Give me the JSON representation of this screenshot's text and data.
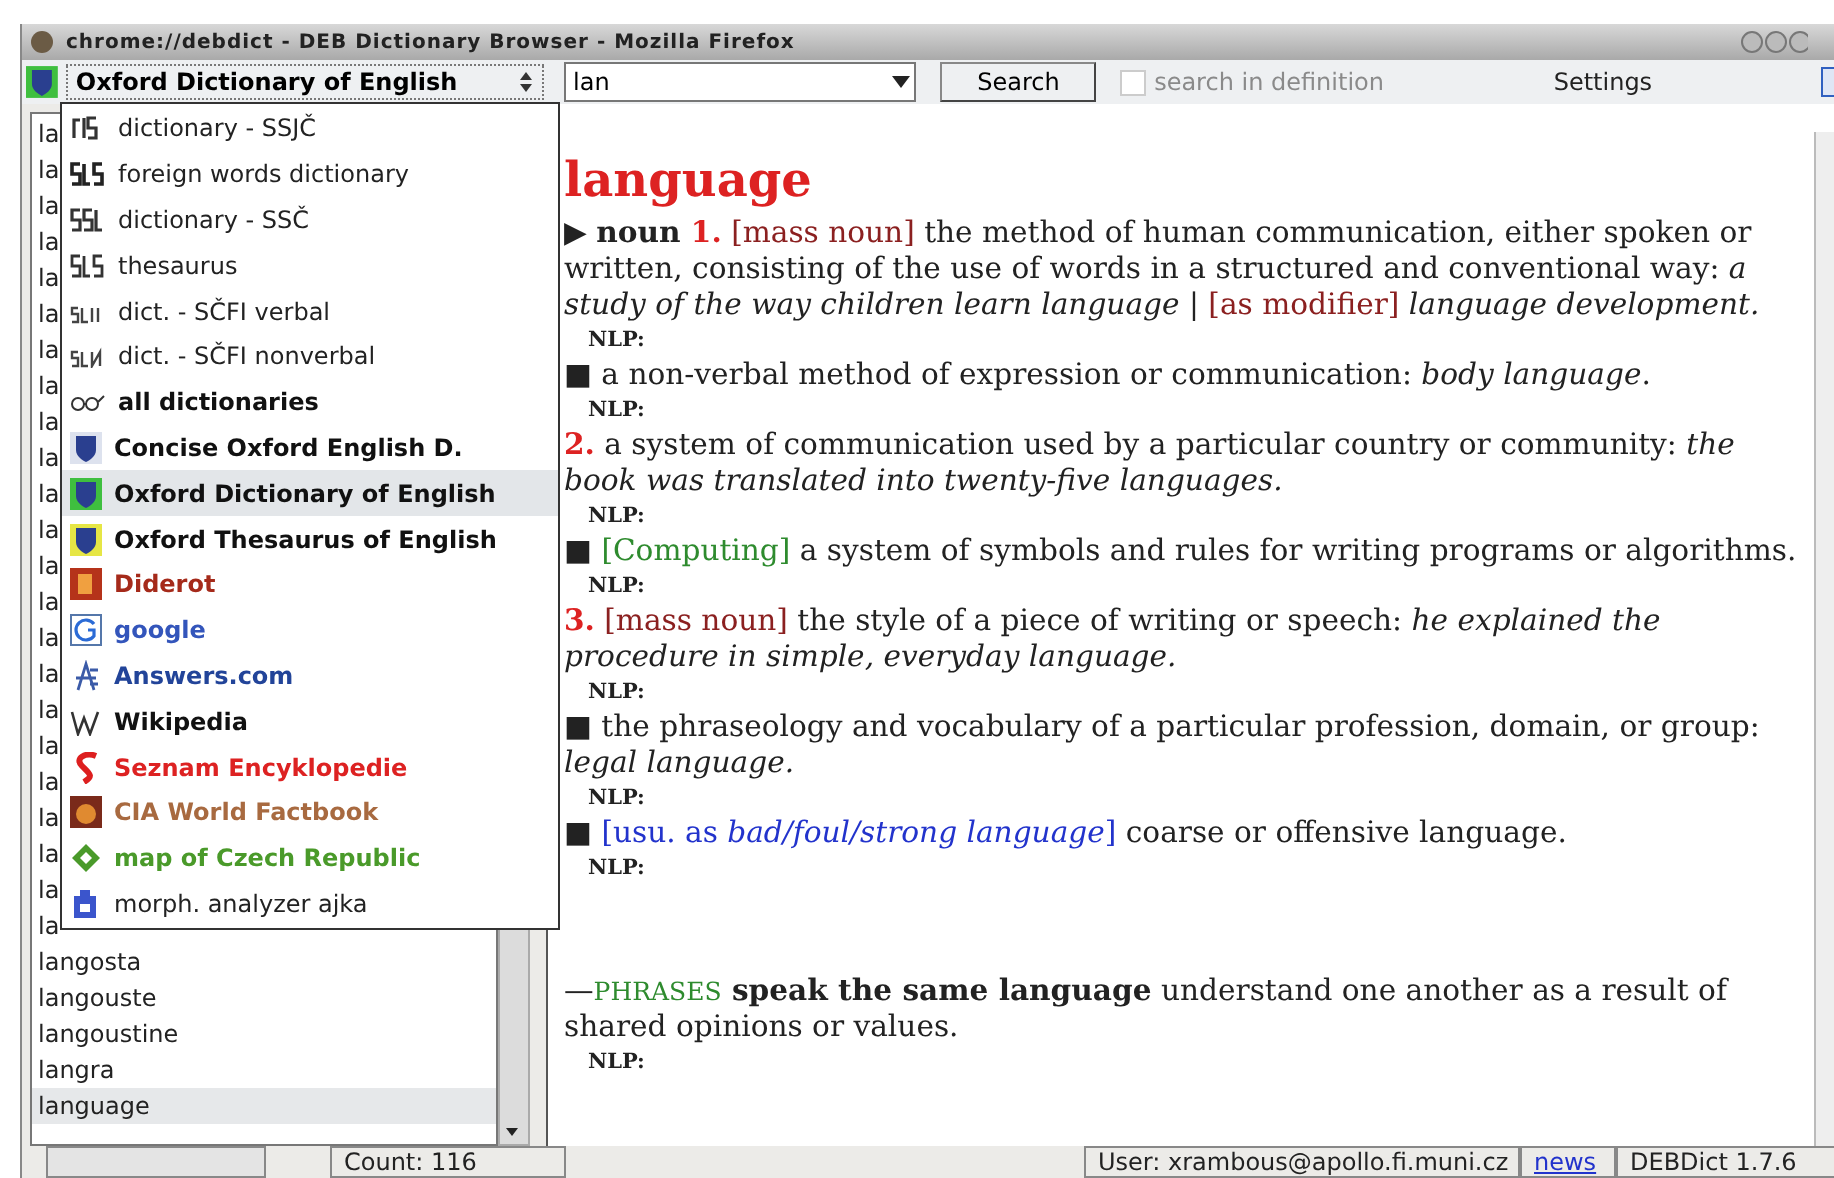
{
  "window": {
    "title": "chrome://debdict - DEB Dictionary Browser - Mozilla Firefox"
  },
  "toolbar": {
    "dictionary": "Oxford Dictionary of English",
    "query": "lan",
    "search_button": "Search",
    "search_in_definition": {
      "label": "search in definition",
      "checked": false,
      "disabled": true
    },
    "settings": "Settings"
  },
  "dictionary_menu": [
    {
      "label": "dictionary - SSJČ",
      "bold": false,
      "selected": false,
      "color": "#222222"
    },
    {
      "label": "foreign words dictionary",
      "bold": false,
      "selected": false,
      "color": "#222222"
    },
    {
      "label": "dictionary - SSČ",
      "bold": false,
      "selected": false,
      "color": "#222222"
    },
    {
      "label": "thesaurus",
      "bold": false,
      "selected": false,
      "color": "#222222"
    },
    {
      "label": "dict. - SČFI verbal",
      "bold": false,
      "selected": false,
      "color": "#222222"
    },
    {
      "label": "dict. - SČFI nonverbal",
      "bold": false,
      "selected": false,
      "color": "#222222"
    },
    {
      "label": "all dictionaries",
      "bold": true,
      "selected": false,
      "color": "#111111"
    },
    {
      "label": "Concise Oxford English D.",
      "bold": true,
      "selected": false,
      "color": "#111111"
    },
    {
      "label": "Oxford Dictionary of English",
      "bold": true,
      "selected": true,
      "color": "#111111"
    },
    {
      "label": "Oxford Thesaurus of English",
      "bold": true,
      "selected": false,
      "color": "#111111"
    },
    {
      "label": "Diderot",
      "bold": true,
      "selected": false,
      "color": "#a52a1a"
    },
    {
      "label": "google",
      "bold": true,
      "selected": false,
      "color": "#3355bb"
    },
    {
      "label": "Answers.com",
      "bold": true,
      "selected": false,
      "color": "#224499"
    },
    {
      "label": "Wikipedia",
      "bold": true,
      "selected": false,
      "color": "#111111"
    },
    {
      "label": "Seznam Encyklopedie",
      "bold": true,
      "selected": false,
      "color": "#dd2222"
    },
    {
      "label": "CIA World Factbook",
      "bold": true,
      "selected": false,
      "color": "#a86a40"
    },
    {
      "label": "map of Czech Republic",
      "bold": true,
      "selected": false,
      "color": "#4a9a2a"
    },
    {
      "label": "morph. analyzer ajka",
      "bold": false,
      "selected": false,
      "color": "#222222"
    }
  ],
  "word_list": [
    {
      "word": "la",
      "selected": false
    },
    {
      "word": "la",
      "selected": false
    },
    {
      "word": "la",
      "selected": false
    },
    {
      "word": "la",
      "selected": false
    },
    {
      "word": "la",
      "selected": false
    },
    {
      "word": "la",
      "selected": false
    },
    {
      "word": "la",
      "selected": false
    },
    {
      "word": "la",
      "selected": false
    },
    {
      "word": "la",
      "selected": false
    },
    {
      "word": "la",
      "selected": false
    },
    {
      "word": "la",
      "selected": false
    },
    {
      "word": "la",
      "selected": false
    },
    {
      "word": "la",
      "selected": false
    },
    {
      "word": "la",
      "selected": false
    },
    {
      "word": "la",
      "selected": false
    },
    {
      "word": "la",
      "selected": false
    },
    {
      "word": "la",
      "selected": false
    },
    {
      "word": "la",
      "selected": false
    },
    {
      "word": "la",
      "selected": false
    },
    {
      "word": "la",
      "selected": false
    },
    {
      "word": "la",
      "selected": false
    },
    {
      "word": "la",
      "selected": false
    },
    {
      "word": "la",
      "selected": false
    },
    {
      "word": "langosta",
      "selected": false
    },
    {
      "word": "langouste",
      "selected": false
    },
    {
      "word": "langoustine",
      "selected": false
    },
    {
      "word": "langra",
      "selected": false
    },
    {
      "word": "language",
      "selected": true
    }
  ],
  "entry": {
    "headword": "language",
    "paragraphs": [
      {
        "kind": "text",
        "parts": [
          {
            "kind": "plain",
            "text": "▶ "
          },
          {
            "kind": "bold",
            "text": "noun"
          },
          {
            "kind": "num",
            "text": " 1."
          },
          {
            "kind": "label",
            "text": " [mass noun]"
          },
          {
            "kind": "plain",
            "text": " the method of human communication, either spoken or written, consisting of the use of words in a structured and conventional way: "
          },
          {
            "kind": "italic",
            "text": "a study of the way children learn language"
          },
          {
            "kind": "plain",
            "text": " | "
          },
          {
            "kind": "label",
            "text": "[as modifier]"
          },
          {
            "kind": "italic",
            "text": " language development."
          }
        ]
      },
      {
        "kind": "nlp",
        "parts": [
          {
            "kind": "plain",
            "text": "NLP:"
          }
        ]
      },
      {
        "kind": "text",
        "parts": [
          {
            "kind": "plain",
            "text": "■ a non-verbal method of expression or communication: "
          },
          {
            "kind": "italic",
            "text": "body language"
          },
          {
            "kind": "plain",
            "text": "."
          }
        ]
      },
      {
        "kind": "nlp",
        "parts": [
          {
            "kind": "plain",
            "text": "NLP:"
          }
        ]
      },
      {
        "kind": "text",
        "parts": [
          {
            "kind": "num",
            "text": "2."
          },
          {
            "kind": "plain",
            "text": " a system of communication used by a particular country or community: "
          },
          {
            "kind": "italic",
            "text": "the book was translated into twenty-five languages."
          }
        ]
      },
      {
        "kind": "nlp",
        "parts": [
          {
            "kind": "plain",
            "text": "NLP:"
          }
        ]
      },
      {
        "kind": "text",
        "parts": [
          {
            "kind": "plain",
            "text": "■ "
          },
          {
            "kind": "domain",
            "text": "[Computing]"
          },
          {
            "kind": "plain",
            "text": " a system of symbols and rules for writing programs or algorithms."
          }
        ]
      },
      {
        "kind": "nlp",
        "parts": [
          {
            "kind": "plain",
            "text": "NLP:"
          }
        ]
      },
      {
        "kind": "text",
        "parts": [
          {
            "kind": "num",
            "text": "3."
          },
          {
            "kind": "label",
            "text": " [mass noun]"
          },
          {
            "kind": "plain",
            "text": " the style of a piece of writing or speech: "
          },
          {
            "kind": "italic",
            "text": "he explained the procedure in simple, everyday language."
          }
        ]
      },
      {
        "kind": "nlp",
        "parts": [
          {
            "kind": "plain",
            "text": "NLP:"
          }
        ]
      },
      {
        "kind": "text",
        "parts": [
          {
            "kind": "plain",
            "text": "■ the phraseology and vocabulary of a particular profession, domain, or group: "
          },
          {
            "kind": "italic",
            "text": "legal language."
          }
        ]
      },
      {
        "kind": "nlp",
        "parts": [
          {
            "kind": "plain",
            "text": "NLP:"
          }
        ]
      },
      {
        "kind": "text",
        "parts": [
          {
            "kind": "plain",
            "text": "■ "
          },
          {
            "kind": "note",
            "text": "[usu. as "
          },
          {
            "kind": "note_italic",
            "text": "bad/foul/strong language"
          },
          {
            "kind": "note",
            "text": "]"
          },
          {
            "kind": "plain",
            "text": " coarse or offensive language."
          }
        ]
      },
      {
        "kind": "nlp",
        "parts": [
          {
            "kind": "plain",
            "text": "NLP:"
          }
        ]
      },
      {
        "kind": "phrase",
        "parts": [
          {
            "kind": "plain",
            "text": "—"
          },
          {
            "kind": "domain_caps",
            "text": "PHRASES"
          },
          {
            "kind": "bold",
            "text": " speak the same language"
          },
          {
            "kind": "plain",
            "text": " understand one another as a result of shared opinions or values."
          }
        ]
      },
      {
        "kind": "nlp",
        "parts": [
          {
            "kind": "plain",
            "text": "NLP:"
          }
        ]
      }
    ]
  },
  "status_bar": {
    "count": "Count: 116",
    "user": "User:   xrambous@apollo.fi.muni.cz",
    "news": "news",
    "version": "DEBDict 1.7.6"
  }
}
